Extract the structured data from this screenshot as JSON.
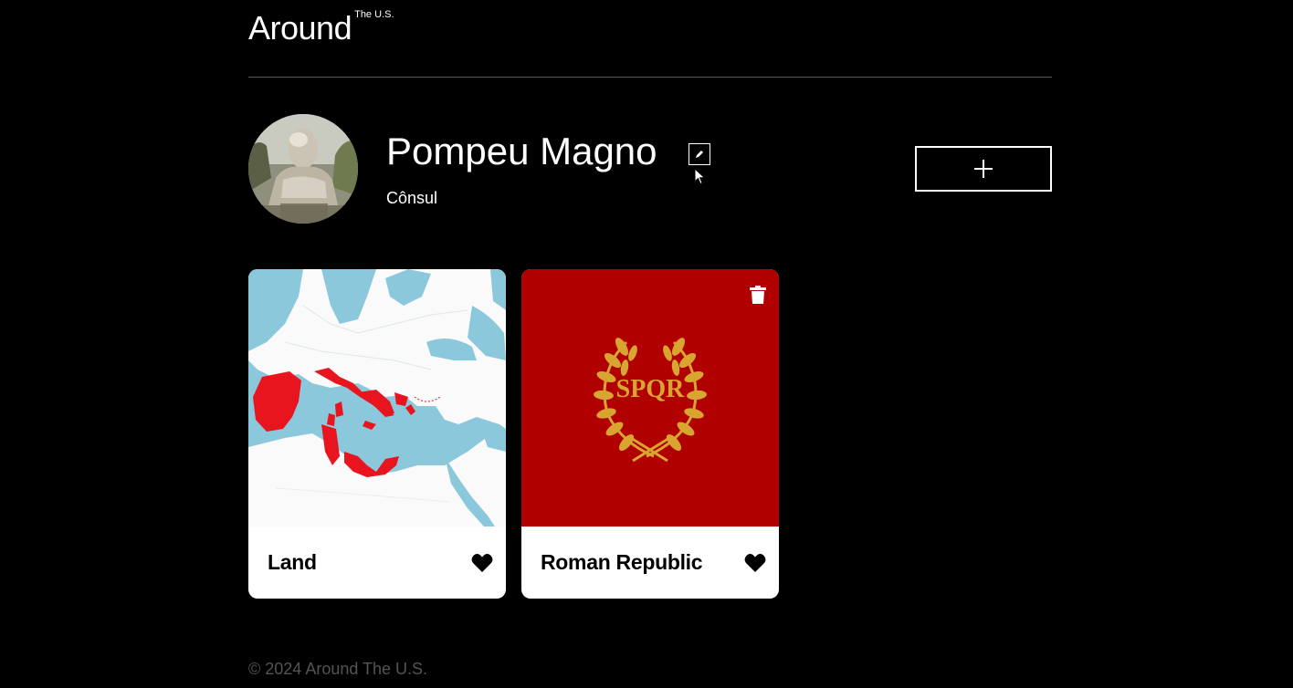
{
  "header": {
    "logo_main": "Around",
    "logo_sup": "The U.S."
  },
  "profile": {
    "name": "Pompeu Magno",
    "job": "Cônsul",
    "avatar_icon": "bust-statue-photo",
    "edit_icon": "pencil-icon",
    "add_icon": "plus-icon"
  },
  "cards": [
    {
      "title": "Land",
      "image": "map-of-roman-territory",
      "like_icon": "heart-icon",
      "liked": false
    },
    {
      "title": "Roman Republic",
      "image": "spqr-laurel-emblem",
      "emblem_text": "SPQR",
      "like_icon": "heart-icon",
      "liked": false,
      "delete_icon": "trash-icon"
    }
  ],
  "footer": {
    "copyright": "© 2024 Around The U.S."
  },
  "colors": {
    "background": "#000000",
    "divider": "#545454",
    "card_bg": "#ffffff",
    "sea": "#8cc8dc",
    "territory": "#e8141e",
    "republic_red": "#b10000",
    "gold": "#d9a531"
  }
}
